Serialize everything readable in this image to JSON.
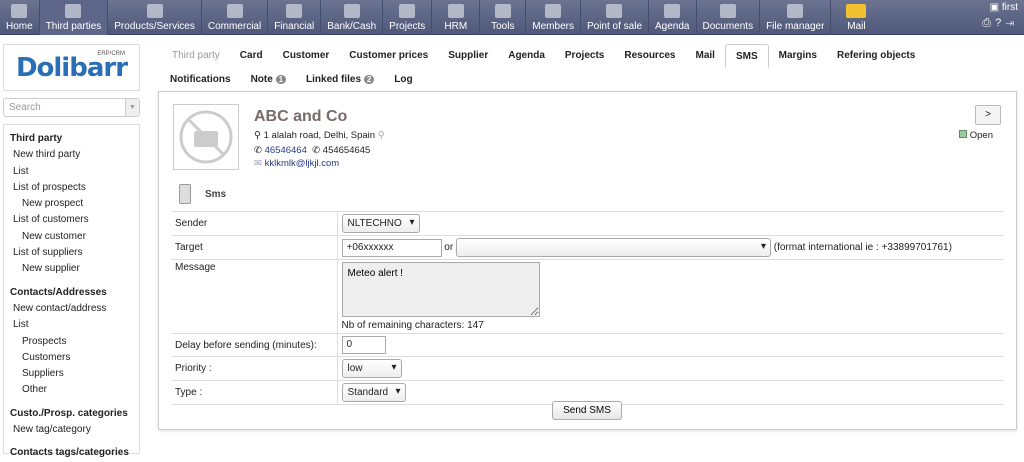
{
  "topmenu": [
    {
      "label": "Home"
    },
    {
      "label": "Third parties"
    },
    {
      "label": "Products/Services"
    },
    {
      "label": "Commercial"
    },
    {
      "label": "Financial"
    },
    {
      "label": "Bank/Cash"
    },
    {
      "label": "Projects"
    },
    {
      "label": "HRM"
    },
    {
      "label": "Tools"
    },
    {
      "label": "Members"
    },
    {
      "label": "Point of sale"
    },
    {
      "label": "Agenda"
    },
    {
      "label": "Documents"
    },
    {
      "label": "File manager"
    },
    {
      "label": "Mail"
    }
  ],
  "user": {
    "name": "first"
  },
  "logo": {
    "text": "Dolibarr",
    "sub": "ERP/CRM"
  },
  "search": {
    "placeholder": "Search"
  },
  "sidebar": {
    "items": [
      "Third party",
      "New third party",
      "List",
      "List of prospects",
      "New prospect",
      "List of customers",
      "New customer",
      "List of suppliers",
      "New supplier",
      "Contacts/Addresses",
      "New contact/address",
      "List",
      "Prospects",
      "Customers",
      "Suppliers",
      "Other",
      "Custo./Prosp. categories",
      "New tag/category",
      "Contacts tags/categories"
    ]
  },
  "tabs": {
    "row1": [
      "Third party",
      "Card",
      "Customer",
      "Customer prices",
      "Supplier",
      "Agenda",
      "Projects",
      "Resources",
      "Mail",
      "SMS",
      "Margins",
      "Refering objects"
    ],
    "row2": [
      "Notifications",
      "Note",
      "Linked files",
      "Log"
    ],
    "note_count": "1",
    "files_count": "2"
  },
  "company": {
    "name": "ABC and Co",
    "address": "1 alalah road, Delhi, Spain",
    "phone": "46546464",
    "fax": "454654645",
    "email": "kklkmlk@ljkjl.com",
    "status": "Open",
    "nav": ">"
  },
  "sms": {
    "title": "Sms",
    "sender_label": "Sender",
    "sender": "NLTECHNO",
    "target_label": "Target",
    "target": "+06xxxxxx",
    "or": "or",
    "target_hint": "(format international ie : +33899701761)",
    "message_label": "Message",
    "message": "Meteo alert !",
    "remaining": "Nb of remaining characters: 147",
    "delay_label": "Delay before sending (minutes):",
    "delay": "0",
    "priority_label": "Priority :",
    "priority": "low",
    "type_label": "Type :",
    "type": "Standard",
    "send": "Send SMS"
  }
}
